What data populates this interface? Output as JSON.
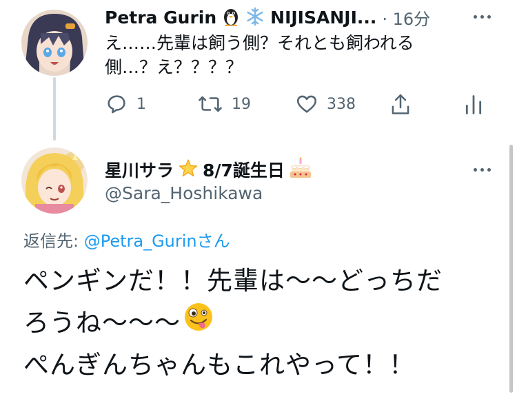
{
  "tweet1": {
    "display_name": "Petra Gurin",
    "name_suffix": "NIJISANJI...",
    "time": "· 16分",
    "text_line1": "え……先輩は飼う側？それとも飼われる",
    "text_line2": "側…？え？？？？",
    "reply_count": "1",
    "retweet_count": "19",
    "like_count": "338",
    "avatar_icon": "penguin-girl-avatar"
  },
  "tweet2": {
    "display_name": "星川サラ",
    "name_suffix": "8/7誕生日",
    "handle": "@Sara_Hoshikawa",
    "reply_prefix": "返信先: ",
    "reply_to": "@Petra_Gurin",
    "reply_suffix": "さん",
    "line1": "ペンギンだ！！先輩は〜〜どっちだ",
    "line2": "ろうね〜〜〜",
    "line3": "ぺんぎんちゃんもこれやって！！",
    "avatar_icon": "blonde-girl-avatar"
  },
  "colors": {
    "text": "#0f1419",
    "muted": "#536471",
    "link": "#1d9bf0",
    "thread_line": "#cfd9de"
  }
}
